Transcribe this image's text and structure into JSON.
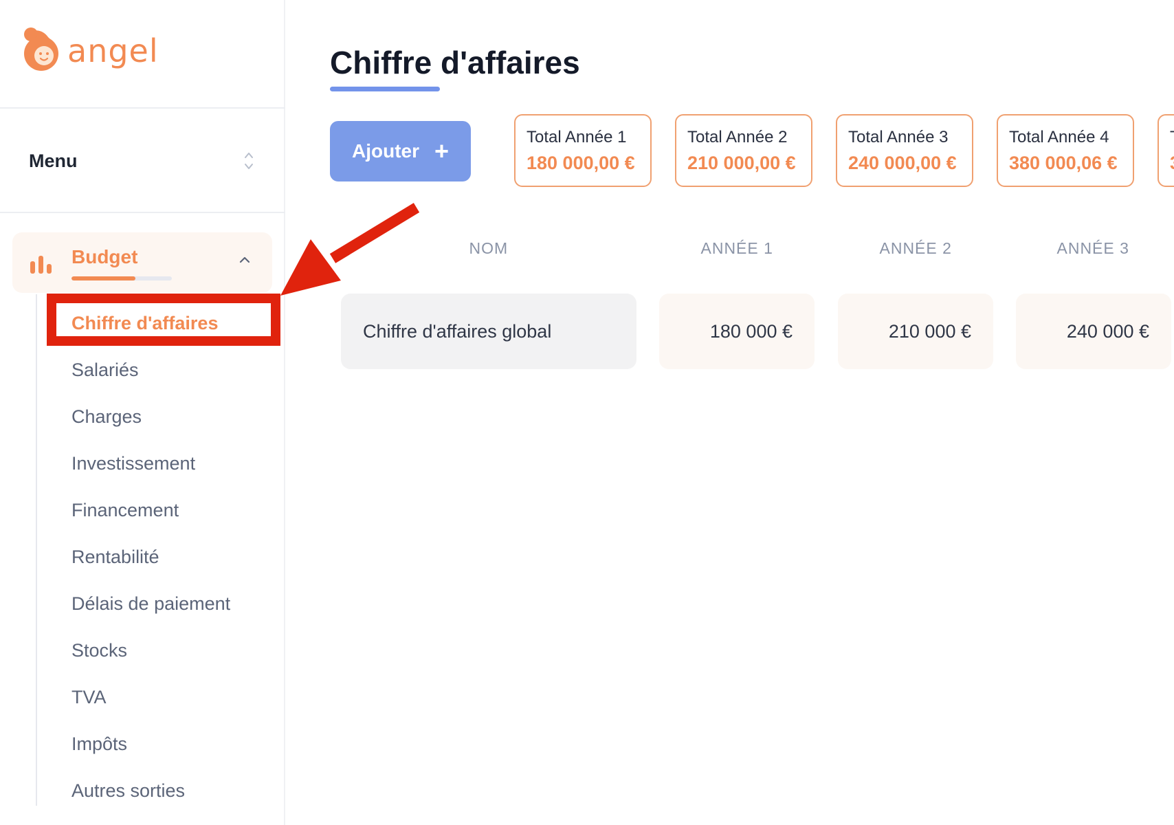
{
  "app": {
    "logo_text": "angel",
    "brand_color": "#f28a52",
    "accent_color": "#7b9be8"
  },
  "sidebar": {
    "menu_label": "Menu",
    "section": {
      "label": "Budget",
      "icon": "bar-chart-icon",
      "progress": 0.64,
      "expanded": true
    },
    "items": [
      {
        "label": "Chiffre d'affaires",
        "active": true
      },
      {
        "label": "Salariés"
      },
      {
        "label": "Charges"
      },
      {
        "label": "Investissement"
      },
      {
        "label": "Financement"
      },
      {
        "label": "Rentabilité"
      },
      {
        "label": "Délais de paiement"
      },
      {
        "label": "Stocks"
      },
      {
        "label": "TVA"
      },
      {
        "label": "Impôts"
      },
      {
        "label": "Autres sorties"
      }
    ]
  },
  "main": {
    "title": "Chiffre d'affaires",
    "add_button": {
      "label": "Ajouter",
      "icon": "plus-icon"
    },
    "totals": [
      {
        "label": "Total Année 1",
        "value": "180 000,00 €"
      },
      {
        "label": "Total Année 2",
        "value": "210 000,00 €"
      },
      {
        "label": "Total Année 3",
        "value": "240 000,00 €"
      },
      {
        "label": "Total Année 4",
        "value": "380 000,06 €"
      },
      {
        "label": "T",
        "value": "3"
      }
    ],
    "table": {
      "columns": [
        "NOM",
        "ANNÉE 1",
        "ANNÉE 2",
        "ANNÉE 3"
      ],
      "rows": [
        {
          "name": "Chiffre d'affaires global",
          "values": [
            "180 000 €",
            "210 000 €",
            "240 000 €"
          ]
        }
      ]
    }
  },
  "annotation": {
    "highlight_color": "#e0230d"
  }
}
